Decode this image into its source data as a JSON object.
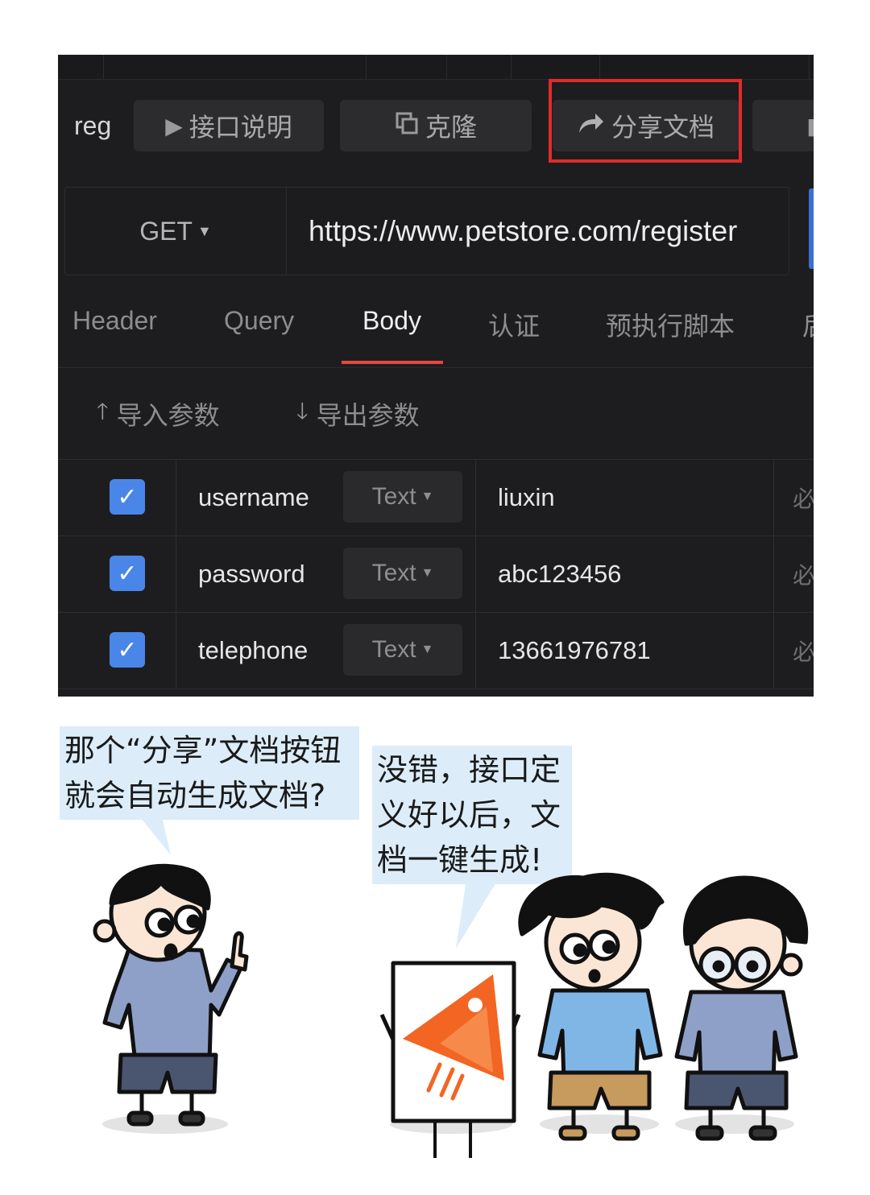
{
  "toolbar": {
    "req_label": "reg",
    "btn_doc": "接口说明",
    "btn_clone": "克隆",
    "btn_share": "分享文档"
  },
  "request": {
    "method": "GET",
    "url": "https://www.petstore.com/register"
  },
  "tabs": [
    "Header",
    "Query",
    "Body",
    "认证",
    "预执行脚本",
    "后"
  ],
  "active_tab": "Body",
  "actions": {
    "import": "导入参数",
    "export": "导出参数"
  },
  "params": [
    {
      "name": "username",
      "type": "Text",
      "value": "liuxin",
      "required": "必"
    },
    {
      "name": "password",
      "type": "Text",
      "value": "abc123456",
      "required": "必"
    },
    {
      "name": "telephone",
      "type": "Text",
      "value": "13661976781",
      "required": "必"
    }
  ],
  "comic": {
    "left_bubble_line1": "那个“分享”文档按钮",
    "left_bubble_line2": "就会自动生成文档?",
    "right_bubble_line1": "没错，接口定",
    "right_bubble_line2": "义好以后，文",
    "right_bubble_line3": "档一键生成!"
  },
  "colors": {
    "panel_bg": "#1d1d1f",
    "highlight_box": "#e02b2b",
    "tab_underline": "#e5483f",
    "checkbox": "#4a86e8",
    "bubble_bg": "#dcedf9",
    "logo_orange": "#f26522"
  }
}
